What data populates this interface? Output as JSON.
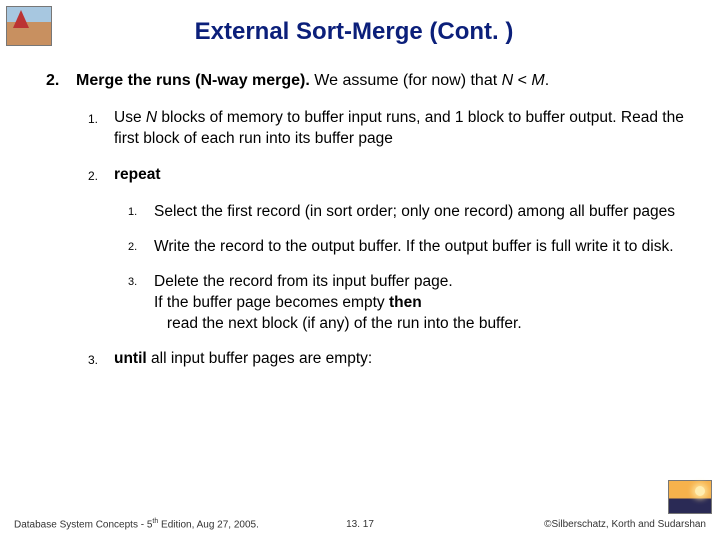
{
  "title": "External Sort-Merge (Cont. )",
  "main": {
    "num": "2.",
    "bold": "Merge the runs (N-way merge). ",
    "rest1": "We assume (for now) that ",
    "var1": "N",
    "rest2": " < ",
    "var2": "M",
    "rest3": "."
  },
  "sub": [
    {
      "num": "1.",
      "pre": "Use ",
      "var": "N",
      "post": " blocks of memory to buffer input runs, and 1 block to buffer output. Read the first block of each run into its buffer page"
    },
    {
      "num": "2.",
      "bold": "repeat"
    },
    {
      "num": "3.",
      "bold": "until",
      "rest": " all input buffer pages are empty:"
    }
  ],
  "subsub": [
    {
      "num": "1.",
      "text": "Select the first record (in sort order; only one record) among all buffer pages"
    },
    {
      "num": "2.",
      "text": "Write the record to the output buffer.  If the output buffer is full write it to disk."
    },
    {
      "num": "3.",
      "l1": "Delete the record from its input buffer page.",
      "l2a": "If the buffer page becomes empty ",
      "l2b": "then",
      "l3": "   read the next block (if any) of the run into the buffer."
    }
  ],
  "footer": {
    "left1": "Database System Concepts - 5",
    "left_sup": "th",
    "left2": " Edition, Aug 27, 2005.",
    "center": "13. 17",
    "right": "©Silberschatz, Korth and Sudarshan"
  }
}
